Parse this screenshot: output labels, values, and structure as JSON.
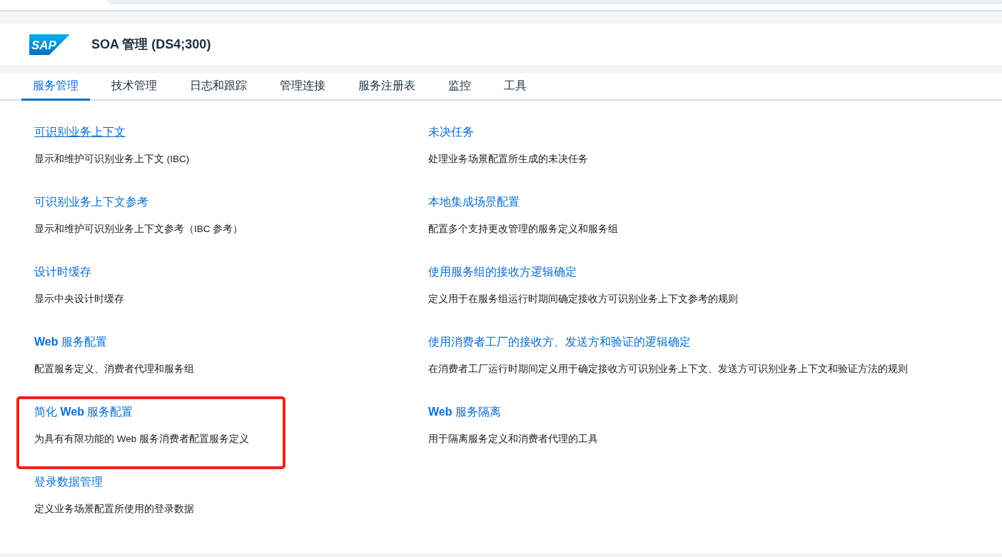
{
  "header": {
    "logo": "SAP",
    "title": "SOA 管理 (DS4;300)"
  },
  "tabs": [
    {
      "label": "服务管理",
      "selected": true
    },
    {
      "label": "技术管理",
      "selected": false
    },
    {
      "label": "日志和跟踪",
      "selected": false
    },
    {
      "label": "管理连接",
      "selected": false
    },
    {
      "label": "服务注册表",
      "selected": false
    },
    {
      "label": "监控",
      "selected": false
    },
    {
      "label": "工具",
      "selected": false
    }
  ],
  "columns": [
    [
      {
        "title": "可识别业务上下文",
        "description": "显示和维护可识别业务上下文 (IBC)",
        "hovered": true,
        "highlighted": false
      },
      {
        "title": "可识别业务上下文参考",
        "description": "显示和维护可识别业务上下文参考（IBC 参考）",
        "hovered": false,
        "highlighted": false
      },
      {
        "title": "设计时缓存",
        "description": "显示中央设计时缓存",
        "hovered": false,
        "highlighted": false
      },
      {
        "title": "**Web** 服务配置",
        "description": "配置服务定义、消费者代理和服务组",
        "hovered": false,
        "highlighted": false
      },
      {
        "title": "简化 **Web** 服务配置",
        "description": "为具有有限功能的 Web 服务消费者配置服务定义",
        "hovered": false,
        "highlighted": true
      },
      {
        "title": "登录数据管理",
        "description": "定义业务场景配置所使用的登录数据",
        "hovered": false,
        "highlighted": false
      }
    ],
    [
      {
        "title": "未决任务",
        "description": "处理业务场景配置所生成的未决任务",
        "hovered": false,
        "highlighted": false
      },
      {
        "title": "本地集成场景配置",
        "description": "配置多个支持更改管理的服务定义和服务组",
        "hovered": false,
        "highlighted": false
      },
      {
        "title": "使用服务组的接收方逻辑确定",
        "description": "定义用于在服务组运行时期间确定接收方可识别业务上下文参考的规则",
        "hovered": false,
        "highlighted": false
      },
      {
        "title": "使用消费者工厂的接收方、发送方和验证的逻辑确定",
        "description": "在消费者工厂运行时期间定义用于确定接收方可识别业务上下文、发送方可识别业务上下文和验证方法的规则",
        "hovered": false,
        "highlighted": false
      },
      {
        "title": "**Web** 服务隔离",
        "description": "用于隔离服务定义和消费者代理的工具",
        "hovered": false,
        "highlighted": false
      }
    ]
  ]
}
